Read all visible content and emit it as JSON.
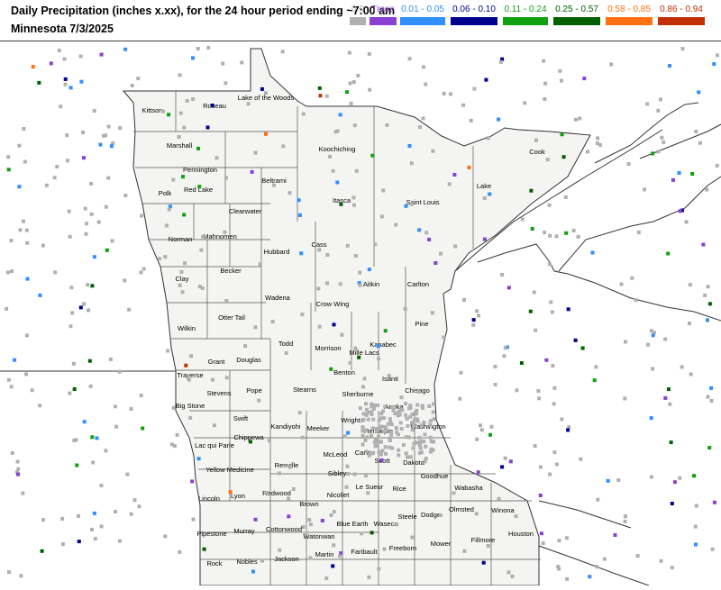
{
  "header": {
    "title": "Daily Precipitation (inches  x.xx),  for the 24 hour period ending ~7:00 am",
    "subtitle": "Minnesota 7/3/2025"
  },
  "legend": [
    {
      "label": "0.0",
      "color": "#b0b0b0",
      "text_color": "#b0b0b0"
    },
    {
      "label": "Trace",
      "color": "#8a40d0",
      "text_color": "#8a40d0"
    },
    {
      "label": "0.01 - 0.05",
      "color": "#2f8fff",
      "text_color": "#2f8fff"
    },
    {
      "label": "0.06 - 0.10",
      "color": "#000090",
      "text_color": "#000090"
    },
    {
      "label": "0.11 - 0.24",
      "color": "#10a010",
      "text_color": "#10a010"
    },
    {
      "label": "0.25 - 0.57",
      "color": "#006000",
      "text_color": "#006000"
    },
    {
      "label": "0.58 - 0.85",
      "color": "#ff7010",
      "text_color": "#ff7010"
    },
    {
      "label": "0.86 - 0.94",
      "color": "#c03000",
      "text_color": "#c03000"
    }
  ],
  "counties": [
    {
      "name": "Kittson",
      "col": 169,
      "row": 79
    },
    {
      "name": "Roseau",
      "col": 238,
      "row": 74
    },
    {
      "name": "Lake of the Woods",
      "col": 295,
      "row": 65
    },
    {
      "name": "Marshall",
      "col": 199,
      "row": 118
    },
    {
      "name": "Koochiching",
      "col": 374,
      "row": 122
    },
    {
      "name": "Cook",
      "col": 596,
      "row": 125
    },
    {
      "name": "Pennington",
      "col": 222,
      "row": 145
    },
    {
      "name": "Beltrami",
      "col": 304,
      "row": 157
    },
    {
      "name": "Polk",
      "col": 183,
      "row": 171
    },
    {
      "name": "Red Lake",
      "col": 220,
      "row": 167
    },
    {
      "name": "Lake",
      "col": 537,
      "row": 163
    },
    {
      "name": "Itasca",
      "col": 379,
      "row": 179
    },
    {
      "name": "Saint Louis",
      "col": 469,
      "row": 181
    },
    {
      "name": "Clearwater",
      "col": 272,
      "row": 191
    },
    {
      "name": "Norman",
      "col": 200,
      "row": 222
    },
    {
      "name": "Mahnomen",
      "col": 244,
      "row": 219
    },
    {
      "name": "Cass",
      "col": 354,
      "row": 228
    },
    {
      "name": "Hubbard",
      "col": 307,
      "row": 236
    },
    {
      "name": "Becker",
      "col": 256,
      "row": 257
    },
    {
      "name": "Clay",
      "col": 202,
      "row": 266
    },
    {
      "name": "Aitkin",
      "col": 412,
      "row": 272
    },
    {
      "name": "Carlton",
      "col": 464,
      "row": 272
    },
    {
      "name": "Wadena",
      "col": 308,
      "row": 287
    },
    {
      "name": "Crow Wing",
      "col": 369,
      "row": 294
    },
    {
      "name": "Otter Tail",
      "col": 257,
      "row": 309
    },
    {
      "name": "Pine",
      "col": 468,
      "row": 316
    },
    {
      "name": "Wilkin",
      "col": 207,
      "row": 321
    },
    {
      "name": "Todd",
      "col": 317,
      "row": 338
    },
    {
      "name": "Morrison",
      "col": 364,
      "row": 343
    },
    {
      "name": "Kanabec",
      "col": 425,
      "row": 339
    },
    {
      "name": "Mille Lacs",
      "col": 404,
      "row": 348
    },
    {
      "name": "Grant",
      "col": 240,
      "row": 358
    },
    {
      "name": "Douglas",
      "col": 276,
      "row": 356
    },
    {
      "name": "Traverse",
      "col": 211,
      "row": 373
    },
    {
      "name": "Benton",
      "col": 382,
      "row": 370
    },
    {
      "name": "Isanti",
      "col": 433,
      "row": 377
    },
    {
      "name": "Stevens",
      "col": 243,
      "row": 393
    },
    {
      "name": "Pope",
      "col": 282,
      "row": 390
    },
    {
      "name": "Stearns",
      "col": 338,
      "row": 389
    },
    {
      "name": "Sherburne",
      "col": 397,
      "row": 394
    },
    {
      "name": "Chisago",
      "col": 463,
      "row": 390
    },
    {
      "name": "Big Stone",
      "col": 211,
      "row": 407
    },
    {
      "name": "Anoka",
      "col": 437,
      "row": 408
    },
    {
      "name": "Swift",
      "col": 267,
      "row": 421
    },
    {
      "name": "Wright",
      "col": 389,
      "row": 423
    },
    {
      "name": "Kandiyohi",
      "col": 317,
      "row": 430
    },
    {
      "name": "Meeker",
      "col": 353,
      "row": 432
    },
    {
      "name": "Hennepin",
      "col": 420,
      "row": 435
    },
    {
      "name": "Washington",
      "col": 475,
      "row": 430
    },
    {
      "name": "Chippewa",
      "col": 276,
      "row": 442
    },
    {
      "name": "Lac qui Parle",
      "col": 238,
      "row": 451
    },
    {
      "name": "McLeod",
      "col": 372,
      "row": 461
    },
    {
      "name": "Carver",
      "col": 405,
      "row": 459
    },
    {
      "name": "Scott",
      "col": 424,
      "row": 468
    },
    {
      "name": "Dakota",
      "col": 459,
      "row": 470
    },
    {
      "name": "Renville",
      "col": 318,
      "row": 473
    },
    {
      "name": "Yellow Medicine",
      "col": 255,
      "row": 478
    },
    {
      "name": "Sibley",
      "col": 374,
      "row": 482
    },
    {
      "name": "Goodhue",
      "col": 482,
      "row": 485
    },
    {
      "name": "Le Sueur",
      "col": 410,
      "row": 497
    },
    {
      "name": "Rice",
      "col": 443,
      "row": 499
    },
    {
      "name": "Wabasha",
      "col": 520,
      "row": 498
    },
    {
      "name": "Lincoln",
      "col": 232,
      "row": 510
    },
    {
      "name": "Lyon",
      "col": 264,
      "row": 507
    },
    {
      "name": "Redwood",
      "col": 307,
      "row": 504
    },
    {
      "name": "Nicollet",
      "col": 375,
      "row": 506
    },
    {
      "name": "Brown",
      "col": 343,
      "row": 516
    },
    {
      "name": "Steele",
      "col": 452,
      "row": 530
    },
    {
      "name": "Dodge",
      "col": 478,
      "row": 528
    },
    {
      "name": "Olmsted",
      "col": 512,
      "row": 522
    },
    {
      "name": "Winona",
      "col": 558,
      "row": 523
    },
    {
      "name": "Blue Earth",
      "col": 391,
      "row": 538
    },
    {
      "name": "Waseca",
      "col": 428,
      "row": 538
    },
    {
      "name": "Pipestone",
      "col": 235,
      "row": 549
    },
    {
      "name": "Murray",
      "col": 271,
      "row": 546
    },
    {
      "name": "Cottonwood",
      "col": 315,
      "row": 544
    },
    {
      "name": "Watonwan",
      "col": 354,
      "row": 552
    },
    {
      "name": "Fillmore",
      "col": 536,
      "row": 556
    },
    {
      "name": "Houston",
      "col": 578,
      "row": 549
    },
    {
      "name": "Faribault",
      "col": 404,
      "row": 569
    },
    {
      "name": "Freeborn",
      "col": 447,
      "row": 565
    },
    {
      "name": "Mower",
      "col": 489,
      "row": 560
    },
    {
      "name": "Martin",
      "col": 360,
      "row": 572
    },
    {
      "name": "Jackson",
      "col": 318,
      "row": 577
    },
    {
      "name": "Nobles",
      "col": 274,
      "row": 580
    },
    {
      "name": "Rock",
      "col": 238,
      "row": 582
    }
  ]
}
